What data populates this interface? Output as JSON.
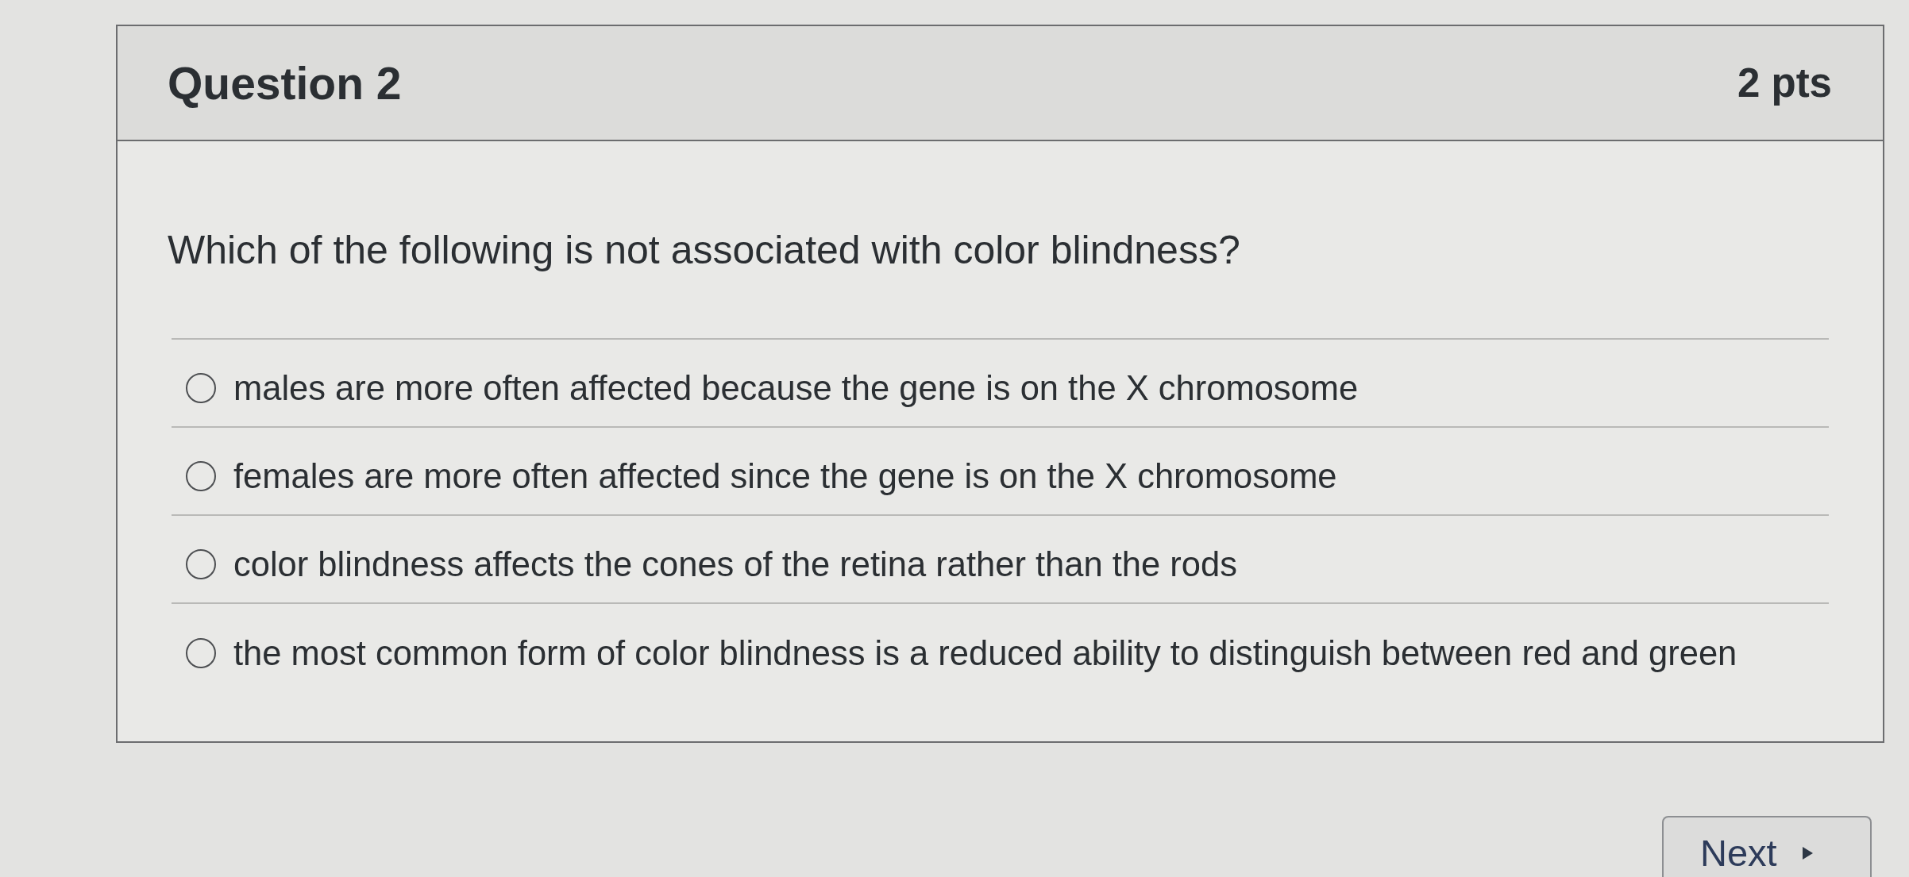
{
  "question": {
    "title": "Question 2",
    "points": "2 pts",
    "text": "Which of the following is not associated with color blindness?",
    "answers": [
      {
        "label": "males are more often affected because the gene is on the X chromosome",
        "selected": false
      },
      {
        "label": "females are more often affected since the gene is on the X chromosome",
        "selected": false
      },
      {
        "label": "color blindness affects the cones of the retina rather than the rods",
        "selected": false
      },
      {
        "label": "the most common form of color blindness is a reduced ability to distinguish between red and green",
        "selected": false
      }
    ]
  },
  "navigation": {
    "next_button": "Next"
  }
}
